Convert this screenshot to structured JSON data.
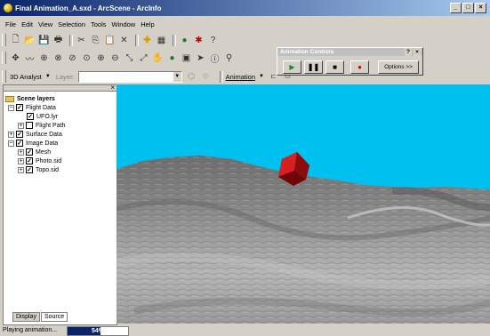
{
  "window": {
    "title": "Final Animation_A.sxd - ArcScene - ArcInfo"
  },
  "menu": [
    "File",
    "Edit",
    "View",
    "Selection",
    "Tools",
    "Window",
    "Help"
  ],
  "toolbar3": {
    "analyst_label": "3D Analyst",
    "layer_label": "Layer:",
    "layer_value": "",
    "animation_label": "Animation"
  },
  "layers": {
    "root": "Scene layers",
    "items": [
      {
        "label": "Flight Data",
        "expanded": true,
        "checked": true,
        "level": 0
      },
      {
        "label": "UFO.lyr",
        "checked": true,
        "level": 1
      },
      {
        "label": "Flight Path",
        "checked": false,
        "level": 1
      },
      {
        "label": "Surface Data",
        "checked": true,
        "level": 0
      },
      {
        "label": "Image Data",
        "expanded": true,
        "checked": true,
        "level": 0
      },
      {
        "label": "Mesh",
        "checked": true,
        "level": 1
      },
      {
        "label": "Photo.sid",
        "checked": true,
        "level": 1
      },
      {
        "label": "Topo.sid",
        "checked": true,
        "level": 1
      }
    ]
  },
  "tabs": [
    "Display",
    "Source"
  ],
  "animation_controls": {
    "title": "Animation Controls",
    "options_label": "Options >>",
    "help": "?",
    "close": "×"
  },
  "status": {
    "text": "Playing animation...",
    "progress_label": "54%",
    "progress": 0.54
  }
}
